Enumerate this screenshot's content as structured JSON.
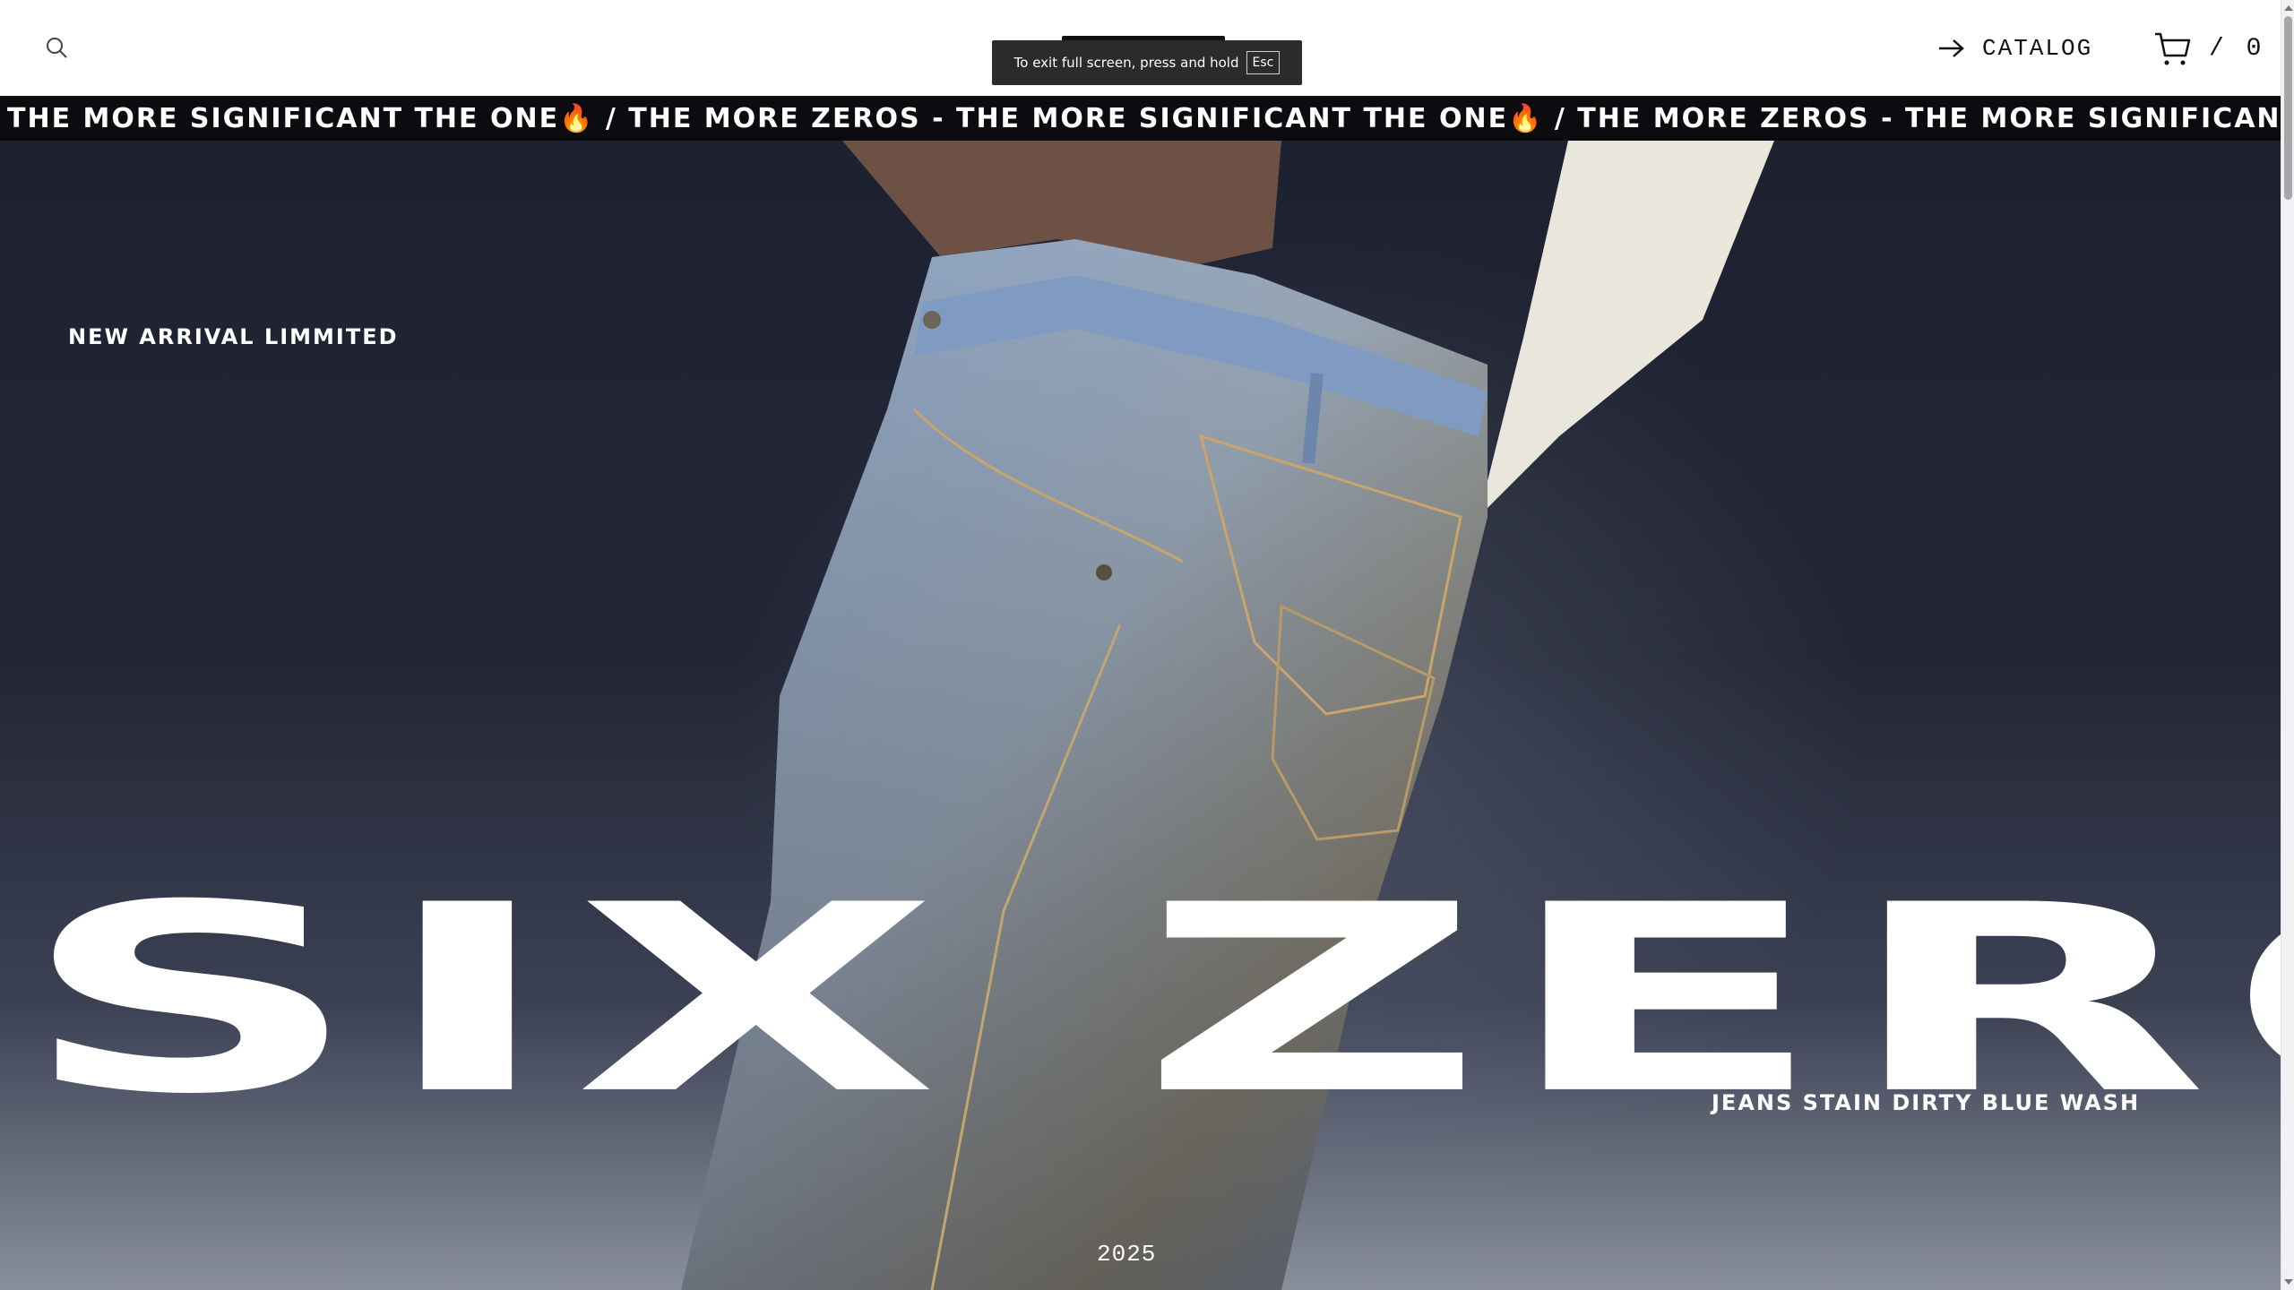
{
  "header": {
    "search_icon": "search-icon",
    "catalog_label": "CATALOG",
    "cart_label": "/ 0",
    "cart_icon": "cart-icon"
  },
  "fullscreen_notice": {
    "text": "To exit full screen, press and hold",
    "key": "Esc"
  },
  "marquee": {
    "text": "THE MORE SIGNIFICANT THE ONE🔥 / THE MORE ZEROS - THE MORE SIGNIFICANT THE ONE🔥 / THE MORE ZEROS - THE MORE SIGNIFICANT THE ONE🔥 / T"
  },
  "hero": {
    "tagline": "NEW ARRIVAL LIMMITED",
    "title": "SIX ZEROS",
    "product_name": "JEANS STAIN DIRTY BLUE WASH",
    "year": "2025"
  },
  "colors": {
    "header_bg": "#ffffff",
    "marquee_bg": "#0b0b10",
    "hero_bg": "#1f2331",
    "text_light": "#ffffff"
  }
}
